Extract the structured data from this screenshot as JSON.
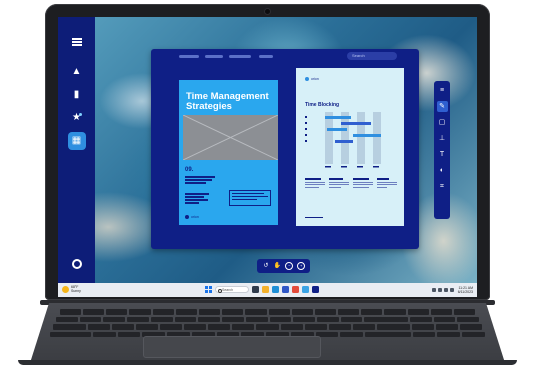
{
  "device": {
    "type": "laptop"
  },
  "sidebar": {
    "items": [
      {
        "icon": "menu-icon"
      },
      {
        "icon": "triangle-icon"
      },
      {
        "icon": "bar-chart-icon"
      },
      {
        "icon": "star-icon"
      },
      {
        "icon": "grid-icon",
        "active": true
      },
      {
        "icon": "ring-icon"
      }
    ],
    "background": "#0d1d78"
  },
  "app": {
    "search": {
      "placeholder": "Search"
    },
    "page_left": {
      "title": "Time Management Strategies",
      "section_number": "09.",
      "brand": "orion",
      "background": "#2aa7ee"
    },
    "page_right": {
      "brand": "orion",
      "section_title": "Time Blocking",
      "background": "#d7f0f8"
    }
  },
  "pen_toolbar": {
    "tools": [
      "list-icon",
      "pen-icon",
      "note-icon",
      "anchor-icon",
      "text-icon",
      "color-icon",
      "crop-icon"
    ],
    "active": "pen-icon"
  },
  "bottom_toolbar": {
    "tools": [
      "undo-icon",
      "hand-icon",
      "zoom-out-icon",
      "zoom-in-icon"
    ]
  },
  "taskbar": {
    "weather_temp": "68°F",
    "weather_desc": "Sunny",
    "search_placeholder": "Search",
    "clock_time": "11:21 AM",
    "clock_date": "6/11/2023"
  },
  "colors": {
    "accent": "#2f8fe0",
    "navy": "#0f1f86",
    "sky": "#2aa7ee"
  }
}
